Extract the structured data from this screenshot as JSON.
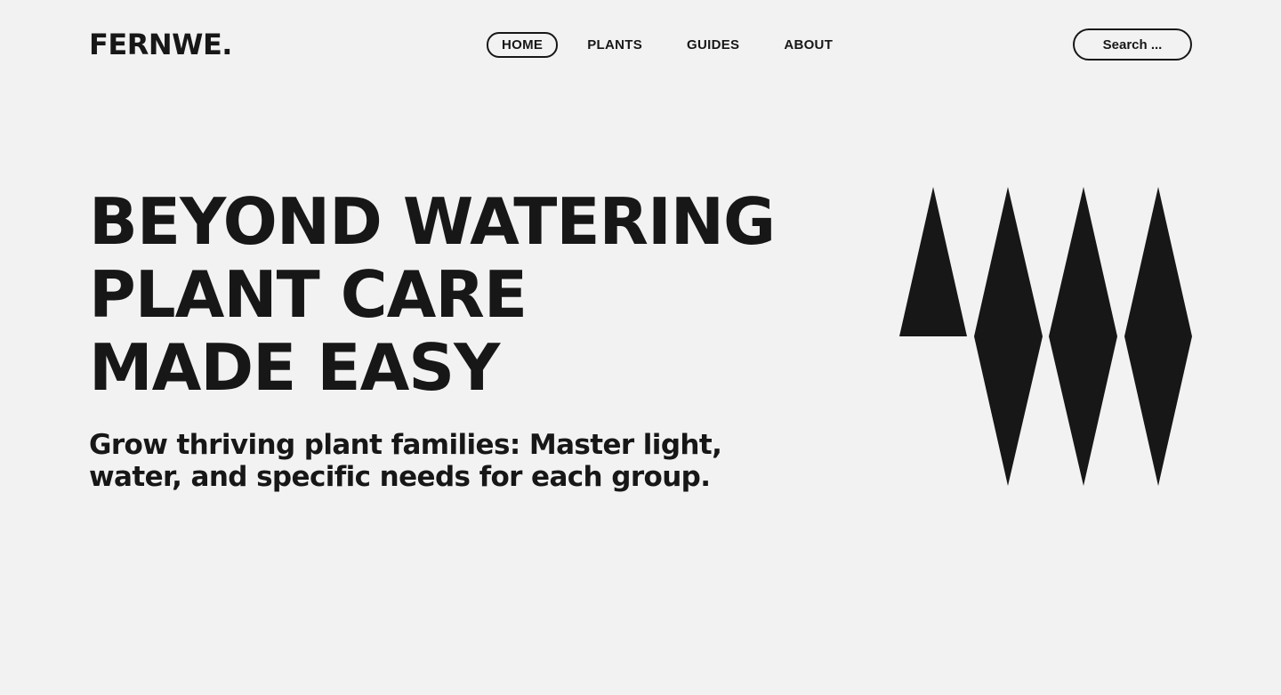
{
  "header": {
    "logo": "FERNWE.",
    "nav": [
      {
        "label": "HOME",
        "active": true
      },
      {
        "label": "PLANTS",
        "active": false
      },
      {
        "label": "GUIDES",
        "active": false
      },
      {
        "label": "ABOUT",
        "active": false
      }
    ],
    "search": {
      "placeholder": "Search ...",
      "value": ""
    }
  },
  "hero": {
    "title_lines": [
      "BEYOND WATERING",
      "PLANT CARE",
      "MADE EASY"
    ],
    "subtitle": "Grow thriving plant families: Master light, water, and specific needs for each group."
  },
  "graphic": {
    "icon": "diamond-spikes-icon",
    "color": "#171717"
  },
  "colors": {
    "background": "#f2f2f2",
    "ink": "#171717"
  }
}
